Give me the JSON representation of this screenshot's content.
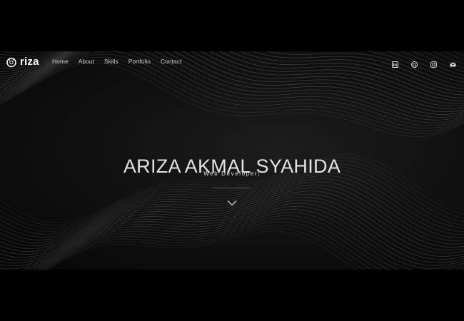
{
  "brand": {
    "name": "riza",
    "logo_icon": "logo-mark-icon"
  },
  "nav": {
    "items": [
      {
        "label": "Home"
      },
      {
        "label": "About"
      },
      {
        "label": "Skills"
      },
      {
        "label": "Portfolio"
      },
      {
        "label": "Contact"
      }
    ]
  },
  "social": {
    "items": [
      {
        "name": "linkedin-icon"
      },
      {
        "name": "github-icon"
      },
      {
        "name": "instagram-icon"
      },
      {
        "name": "mail-icon"
      }
    ]
  },
  "hero": {
    "title": "ARIZA AKMAL SYAHIDA",
    "subtitle": "Web Developer",
    "cursor": "|",
    "scroll_icon": "chevron-down-icon"
  },
  "colors": {
    "background": "#000000",
    "hero_text": "#e2e2e2",
    "nav_text": "#c9c9c9"
  }
}
